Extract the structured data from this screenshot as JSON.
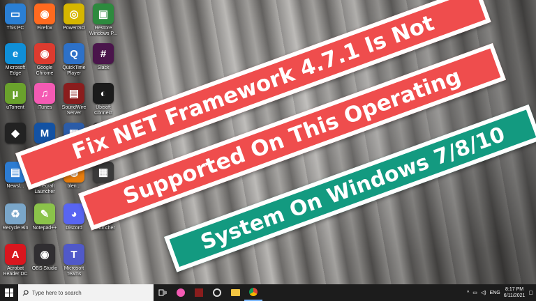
{
  "desktop_icons": [
    {
      "label": "This PC",
      "icon": "this-pc-icon",
      "color": "#2a7fd4",
      "glyph": "▭"
    },
    {
      "label": "Firefox",
      "icon": "firefox-icon",
      "color": "#ff6a1f",
      "glyph": "◉"
    },
    {
      "label": "PowerISO",
      "icon": "poweriso-icon",
      "color": "#d6b600",
      "glyph": "◎"
    },
    {
      "label": "Restore\nWindows P...",
      "icon": "restore-windows-icon",
      "color": "#2d8a3e",
      "glyph": "▣"
    },
    {
      "label": "Microsoft\nEdge",
      "icon": "edge-icon",
      "color": "#0f8fd8",
      "glyph": "e"
    },
    {
      "label": "Google\nChrome",
      "icon": "chrome-icon",
      "color": "#dd3b2f",
      "glyph": "◉"
    },
    {
      "label": "QuickTime\nPlayer",
      "icon": "quicktime-icon",
      "color": "#2d71c8",
      "glyph": "Q"
    },
    {
      "label": "Slack",
      "icon": "slack-icon",
      "color": "#4a154b",
      "glyph": "#"
    },
    {
      "label": "uTorrent",
      "icon": "utorrent-icon",
      "color": "#6aa22c",
      "glyph": "µ"
    },
    {
      "label": "iTunes",
      "icon": "itunes-icon",
      "color": "#f45ab3",
      "glyph": "♫"
    },
    {
      "label": "SoundWire\nServer",
      "icon": "soundwire-icon",
      "color": "#8a1d1d",
      "glyph": "▤"
    },
    {
      "label": "Ubisoft\nConnect",
      "icon": "ubisoft-icon",
      "color": "#1b1b1b",
      "glyph": "◐"
    },
    {
      "label": "",
      "icon": "unity-icon",
      "color": "#222222",
      "glyph": "◆"
    },
    {
      "label": "",
      "icon": "malwarebytes-icon",
      "color": "#1352a3",
      "glyph": "M"
    },
    {
      "label": "",
      "icon": "app-icon",
      "color": "#2b5ca8",
      "glyph": "▦"
    },
    {
      "label": "",
      "icon": "app-icon",
      "color": "#333333",
      "glyph": "▦"
    },
    {
      "label": "Newsl...",
      "icon": "news-icon",
      "color": "#2c7cd3",
      "glyph": "▤"
    },
    {
      "label": "Minecraft\nLauncher",
      "icon": "minecraft-icon",
      "color": "#5b8b32",
      "glyph": "▩"
    },
    {
      "label": "blen...",
      "icon": "blender-icon",
      "color": "#e87d0d",
      "glyph": "◍"
    },
    {
      "label": "",
      "icon": "app-icon",
      "color": "#3a3a3a",
      "glyph": "▦"
    },
    {
      "label": "Recycle Bin",
      "icon": "recycle-bin-icon",
      "color": "#7aa6c9",
      "glyph": "♻"
    },
    {
      "label": "Notepad++",
      "icon": "notepadpp-icon",
      "color": "#8bc34a",
      "glyph": "✎"
    },
    {
      "label": "Discord",
      "icon": "discord-icon",
      "color": "#5865f2",
      "glyph": "◕"
    },
    {
      "label": "TLauncher",
      "icon": "tlauncher-icon",
      "color": "#1c1c1c",
      "glyph": "T"
    },
    {
      "label": "Acrobat\nReader DC",
      "icon": "acrobat-icon",
      "color": "#d9161e",
      "glyph": "A"
    },
    {
      "label": "OBS Studio",
      "icon": "obs-icon",
      "color": "#302e31",
      "glyph": "◉"
    },
    {
      "label": "Microsoft\nTeams",
      "icon": "teams-icon",
      "color": "#5059c9",
      "glyph": "T"
    }
  ],
  "banners": [
    {
      "text": "Fix NET Framework 4.7.1 Is Not",
      "style": "red"
    },
    {
      "text": "Supported On This Operating",
      "style": "red"
    },
    {
      "text": "System On Windows 7/8/10",
      "style": "green"
    }
  ],
  "taskbar": {
    "search_placeholder": "Type here to search",
    "language": "ENG",
    "time": "8:17 PM",
    "date": "6/11/2021"
  }
}
